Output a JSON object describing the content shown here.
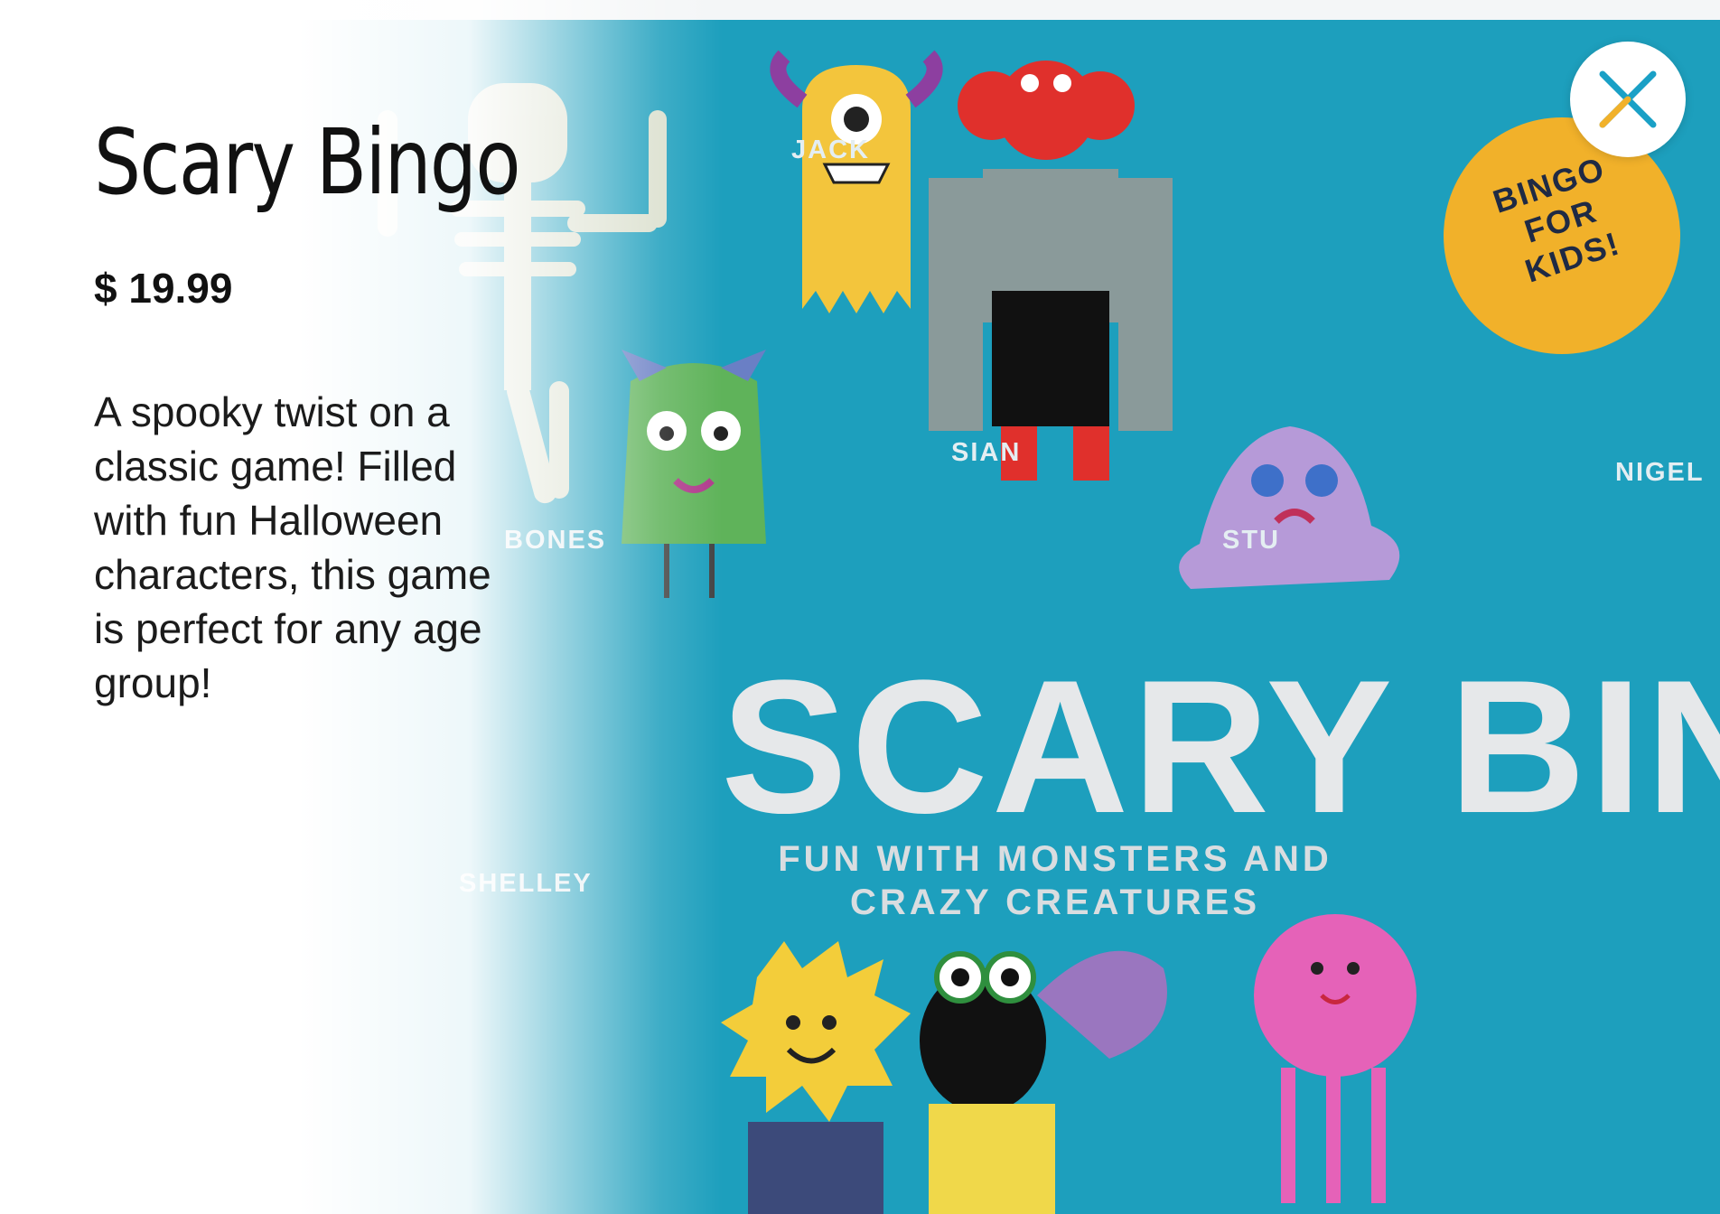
{
  "product": {
    "title": "Scary Bingo",
    "price": "$ 19.99",
    "description": "A spooky twist on a classic game! Filled with fun Halloween characters, this game is perfect for any age group!"
  },
  "box_art": {
    "title": "SCARY BINGO",
    "subtitle": "FUN WITH MONSTERS AND CRAZY CREATURES",
    "badge": "BINGO FOR KIDS!",
    "characters": [
      "JACK",
      "SIAN",
      "STU",
      "NIGEL",
      "BONES",
      "SHELLEY"
    ]
  },
  "icons": {
    "close": "close-icon"
  },
  "colors": {
    "box_background": "#1d9fbd",
    "badge": "#f1b12a",
    "close_accent_blue": "#1aa0c6",
    "close_accent_gold": "#f1b12a"
  }
}
